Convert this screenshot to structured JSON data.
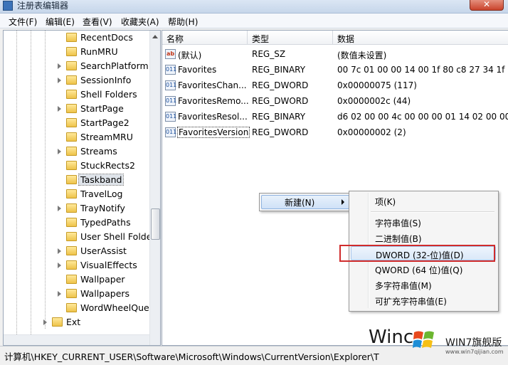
{
  "window": {
    "title": "注册表编辑器",
    "close_label": "✕"
  },
  "menubar": {
    "items": [
      "文件(F)",
      "编辑(E)",
      "查看(V)",
      "收藏夹(A)",
      "帮助(H)"
    ]
  },
  "tree": {
    "items": [
      {
        "label": "RecentDocs",
        "expandable": false
      },
      {
        "label": "RunMRU",
        "expandable": false
      },
      {
        "label": "SearchPlatform",
        "expandable": true
      },
      {
        "label": "SessionInfo",
        "expandable": true
      },
      {
        "label": "Shell Folders",
        "expandable": false
      },
      {
        "label": "StartPage",
        "expandable": true
      },
      {
        "label": "StartPage2",
        "expandable": false
      },
      {
        "label": "StreamMRU",
        "expandable": false
      },
      {
        "label": "Streams",
        "expandable": true
      },
      {
        "label": "StuckRects2",
        "expandable": false
      },
      {
        "label": "Taskband",
        "expandable": false,
        "selected": true
      },
      {
        "label": "TravelLog",
        "expandable": false
      },
      {
        "label": "TrayNotify",
        "expandable": true
      },
      {
        "label": "TypedPaths",
        "expandable": false
      },
      {
        "label": "User Shell Folde",
        "expandable": false
      },
      {
        "label": "UserAssist",
        "expandable": true
      },
      {
        "label": "VisualEffects",
        "expandable": true
      },
      {
        "label": "Wallpaper",
        "expandable": false
      },
      {
        "label": "Wallpapers",
        "expandable": true
      },
      {
        "label": "WordWheelQue",
        "expandable": false
      }
    ],
    "ext_item": "Ext"
  },
  "list": {
    "headers": [
      "名称",
      "类型",
      "数据"
    ],
    "rows": [
      {
        "icon": "ab",
        "name": "(默认)",
        "type": "REG_SZ",
        "data": "(数值未设置)"
      },
      {
        "icon": "011",
        "name": "Favorites",
        "type": "REG_BINARY",
        "data": "00 7c 01 00 00 14 00 1f 80 c8 27 34 1f 10"
      },
      {
        "icon": "011",
        "name": "FavoritesChan...",
        "type": "REG_DWORD",
        "data": "0x00000075 (117)"
      },
      {
        "icon": "011",
        "name": "FavoritesRemo...",
        "type": "REG_DWORD",
        "data": "0x0000002c (44)"
      },
      {
        "icon": "011",
        "name": "FavoritesResol...",
        "type": "REG_BINARY",
        "data": "d6 02 00 00 4c 00 00 00 01 14 02 00 00 0"
      },
      {
        "icon": "011",
        "name": "FavoritesVersion",
        "type": "REG_DWORD",
        "data": "0x00000002 (2)"
      }
    ]
  },
  "context_menu": {
    "new_label": "新建(N)"
  },
  "submenu": {
    "items": [
      {
        "label": "项(K)",
        "sep_after": true
      },
      {
        "label": "字符串值(S)"
      },
      {
        "label": "二进制值(B)"
      },
      {
        "label": "DWORD (32-位)值(D)",
        "hover": true
      },
      {
        "label": "QWORD (64 位)值(Q)"
      },
      {
        "label": "多字符串值(M)"
      },
      {
        "label": "可扩充字符串值(E)"
      }
    ]
  },
  "statusbar": {
    "path": "计算机\\HKEY_CURRENT_USER\\Software\\Microsoft\\Windows\\CurrentVersion\\Explorer\\T"
  },
  "watermark": {
    "win_text": "Winc",
    "brand": "WIN7旗舰版",
    "site": "www.win7qijian.com"
  },
  "colors": {
    "highlight_border": "#d02c2c",
    "folder": "#eec34a"
  }
}
